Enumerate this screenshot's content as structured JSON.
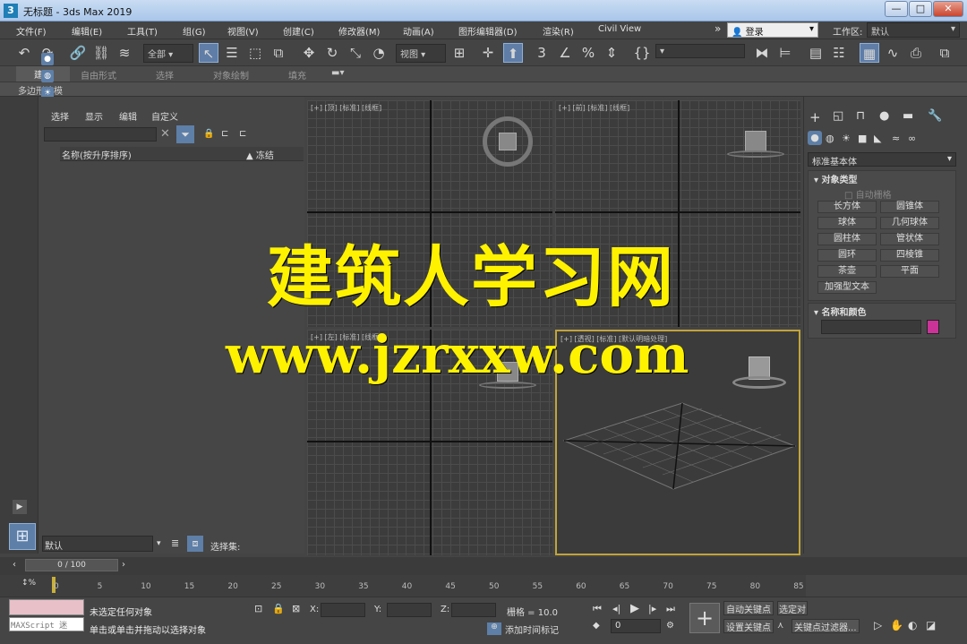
{
  "window": {
    "app_icon": "3",
    "title": "无标题 - 3ds Max 2019",
    "minimize": "—",
    "maximize": "□",
    "close": "✕"
  },
  "menus": [
    "文件(F)",
    "编辑(E)",
    "工具(T)",
    "组(G)",
    "视图(V)",
    "创建(C)",
    "修改器(M)",
    "动画(A)",
    "图形编辑器(D)",
    "渲染(R)",
    "Civil View"
  ],
  "menu_more": "»",
  "login": "登录",
  "workspace_label": "工作区:",
  "workspace_value": "默认",
  "toolbar": {
    "selection_filter": "全部",
    "view_dropdown": "视图"
  },
  "ribbon_tabs": [
    "建模",
    "自由形式",
    "选择",
    "对象绘制",
    "填充"
  ],
  "ribbon_sub": "多边形建模",
  "scene_explorer": {
    "tabs": [
      "选择",
      "显示",
      "编辑",
      "自定义"
    ],
    "search_placeholder": "",
    "col_name": "名称(按升序排序)",
    "col_frozen": "▲ 冻结",
    "layer_value": "默认",
    "selection_set_label": "选择集:"
  },
  "viewports": [
    {
      "label": "[+] [顶] [标准] [线框]"
    },
    {
      "label": "[+] [前] [标准] [线框]"
    },
    {
      "label": "[+] [左] [标准] [线框]"
    },
    {
      "label": "[+] [透视] [标准] [默认明暗处理]"
    }
  ],
  "command_panel": {
    "dropdown": "标准基本体",
    "rollout_object_type": "对象类型",
    "autogrid": "自动栅格",
    "buttons": [
      "长方体",
      "圆锥体",
      "球体",
      "几何球体",
      "圆柱体",
      "管状体",
      "圆环",
      "四棱锥",
      "茶壶",
      "平面",
      "加强型文本"
    ],
    "rollout_name_color": "名称和颜色",
    "object_color": "#cc3399"
  },
  "timeline": {
    "frame": "0 / 100",
    "ticks": [
      "0",
      "5",
      "10",
      "15",
      "20",
      "25",
      "30",
      "35",
      "40",
      "45",
      "50",
      "55",
      "60",
      "65",
      "70",
      "75",
      "80",
      "85"
    ]
  },
  "status": {
    "maxscript": "MAXScript 迷",
    "line1": "未选定任何对象",
    "line2": "单击或单击并拖动以选择对象",
    "x_label": "X:",
    "y_label": "Y:",
    "z_label": "Z:",
    "grid": "栅格 = 10.0",
    "add_time_tag": "添加时间标记",
    "auto_key": "自动关键点",
    "selected_obj": "选定对",
    "set_key": "设置关键点",
    "key_filters": "关键点过滤器...",
    "frame_spinner": "0"
  },
  "watermark": {
    "line1": "建筑人学习网",
    "line2": "www.jzrxxw.com"
  }
}
